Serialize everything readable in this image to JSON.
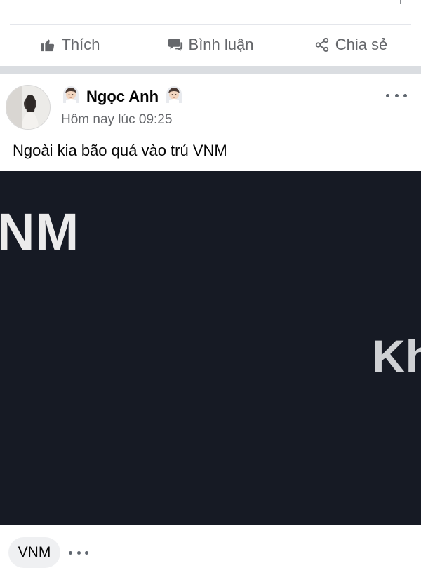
{
  "actions": {
    "like_label": "Thích",
    "comment_label": "Bình luận",
    "share_label": "Chia sẻ"
  },
  "post": {
    "author": "Ngọc Anh",
    "name_emoji_icon": "bride-with-veil-emoji",
    "timestamp": "Hôm nay lúc 09:25",
    "caption": "Ngoài kia bão quá vào trú VNM",
    "image": {
      "text_primary": "NM",
      "text_secondary": "Kh",
      "background": "#161a24"
    }
  },
  "tags": {
    "chip_label": "VNM"
  },
  "colors": {
    "muted_text": "#65676b",
    "separator": "#dadde1",
    "chip_bg": "#eff0f2"
  }
}
